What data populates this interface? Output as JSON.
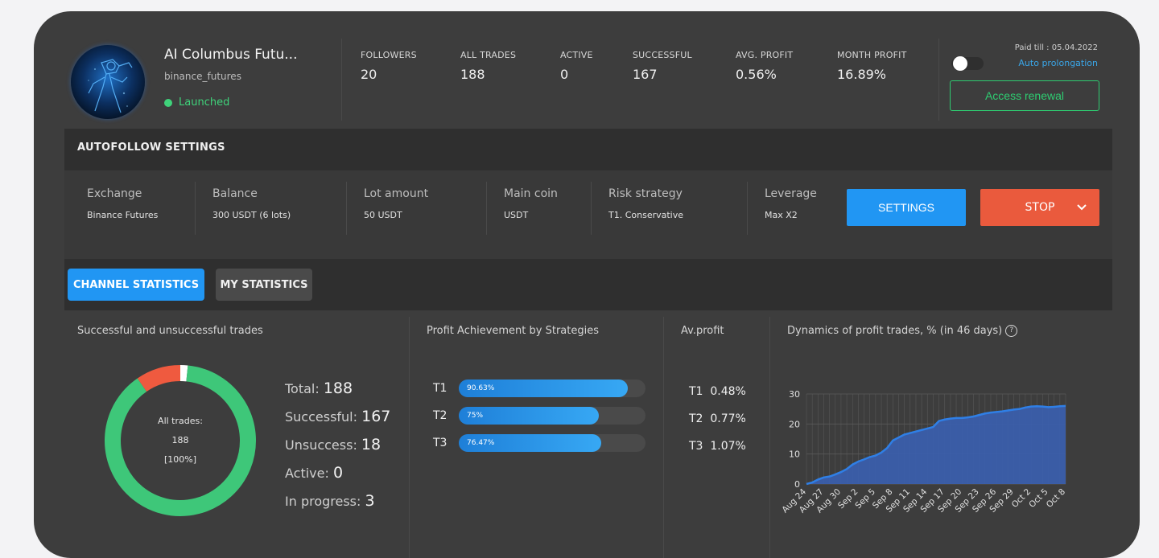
{
  "header": {
    "bot_name": "AI Columbus Futu...",
    "bot_exchange": "binance_futures",
    "status": "Launched",
    "stats": [
      {
        "label": "FOLLOWERS",
        "value": "20"
      },
      {
        "label": "ALL TRADES",
        "value": "188"
      },
      {
        "label": "ACTIVE",
        "value": "0"
      },
      {
        "label": "SUCCESSFUL",
        "value": "167"
      },
      {
        "label": "AVG. PROFIT",
        "value": "0.56%"
      },
      {
        "label": "MONTH PROFIT",
        "value": "16.89%"
      }
    ],
    "paid_till": "Paid till : 05.04.2022",
    "auto_prolongation": "Auto prolongation",
    "access_renewal": "Access renewal",
    "auto_prolongation_on": false
  },
  "autofollow": {
    "title": "AUTOFOLLOW SETTINGS",
    "fields": [
      {
        "label": "Exchange",
        "value": "Binance Futures"
      },
      {
        "label": "Balance",
        "value": "300 USDT (6 lots)"
      },
      {
        "label": "Lot amount",
        "value": "50 USDT"
      },
      {
        "label": "Main coin",
        "value": "USDT"
      },
      {
        "label": "Risk strategy",
        "value": "T1. Conservative"
      },
      {
        "label": "Leverage",
        "value": "Max X2"
      }
    ],
    "settings_label": "SETTINGS",
    "stop_label": "STOP"
  },
  "tabs": {
    "channel": "CHANNEL STATISTICS",
    "mine": "MY STATISTICS"
  },
  "trades_panel": {
    "title": "Successful and unsuccessful trades",
    "donut_center": [
      "All trades:",
      "188",
      "[100%]"
    ],
    "legend": [
      {
        "label": "Total: ",
        "value": "188"
      },
      {
        "label": "Successful: ",
        "value": "167"
      },
      {
        "label": "Unsuccess: ",
        "value": "18"
      },
      {
        "label": "Active: ",
        "value": "0"
      },
      {
        "label": "In progress: ",
        "value": "3"
      }
    ],
    "colors": {
      "success": "#3ec779",
      "fail": "#ef5a3f",
      "progress": "#ffffff"
    }
  },
  "strategies_panel": {
    "title": "Profit Achievement by Strategies",
    "items": [
      {
        "name": "T1",
        "percent_label": "90.63%",
        "percent": 90.63
      },
      {
        "name": "T2",
        "percent_label": "75%",
        "percent": 75
      },
      {
        "name": "T3",
        "percent_label": "76.47%",
        "percent": 76.47
      }
    ]
  },
  "avprofit_panel": {
    "title": "Av.profit",
    "items": [
      {
        "name": "T1",
        "value": "0.48%"
      },
      {
        "name": "T2",
        "value": "0.77%"
      },
      {
        "name": "T3",
        "value": "1.07%"
      }
    ]
  },
  "dynamics_panel": {
    "title": "Dynamics of profit trades, % (in 46 days)"
  },
  "chart_data": {
    "type": "area",
    "title": "",
    "xlabel": "",
    "ylabel": "",
    "ylim": [
      0,
      30
    ],
    "yticks": [
      0,
      10,
      20,
      30
    ],
    "xticks": [
      "Aug 24",
      "Aug 27",
      "Aug 30",
      "Sep 2",
      "Sep 5",
      "Sep 8",
      "Sep 11",
      "Sep 14",
      "Sep 17",
      "Sep 20",
      "Sep 23",
      "Sep 26",
      "Sep 29",
      "Oct 2",
      "Oct 5",
      "Oct 8"
    ],
    "grid": true,
    "color": "#3a5fb0",
    "x": [
      "Aug 24",
      "Aug 25",
      "Aug 26",
      "Aug 27",
      "Aug 28",
      "Aug 29",
      "Aug 30",
      "Aug 31",
      "Sep 1",
      "Sep 2",
      "Sep 3",
      "Sep 4",
      "Sep 5",
      "Sep 6",
      "Sep 7",
      "Sep 8",
      "Sep 9",
      "Sep 10",
      "Sep 11",
      "Sep 12",
      "Sep 13",
      "Sep 14",
      "Sep 15",
      "Sep 16",
      "Sep 17",
      "Sep 18",
      "Sep 19",
      "Sep 20",
      "Sep 21",
      "Sep 22",
      "Sep 23",
      "Sep 24",
      "Sep 25",
      "Sep 26",
      "Sep 27",
      "Sep 28",
      "Sep 29",
      "Sep 30",
      "Oct 1",
      "Oct 2",
      "Oct 3",
      "Oct 4",
      "Oct 5",
      "Oct 6",
      "Oct 7",
      "Oct 8"
    ],
    "values": [
      0,
      0.5,
      1.5,
      2.2,
      2.5,
      3.2,
      4,
      5,
      6.5,
      7.5,
      8.2,
      9,
      9.5,
      10.5,
      12,
      14.5,
      15.5,
      16.5,
      17,
      17.5,
      18,
      18.5,
      19,
      21,
      21.5,
      21.8,
      22,
      22,
      22.2,
      22.5,
      23,
      23.5,
      23.8,
      24,
      24.2,
      24.5,
      24.8,
      25,
      25.5,
      25.8,
      25.9,
      25.8,
      25.6,
      25.7,
      25.9,
      26
    ]
  }
}
